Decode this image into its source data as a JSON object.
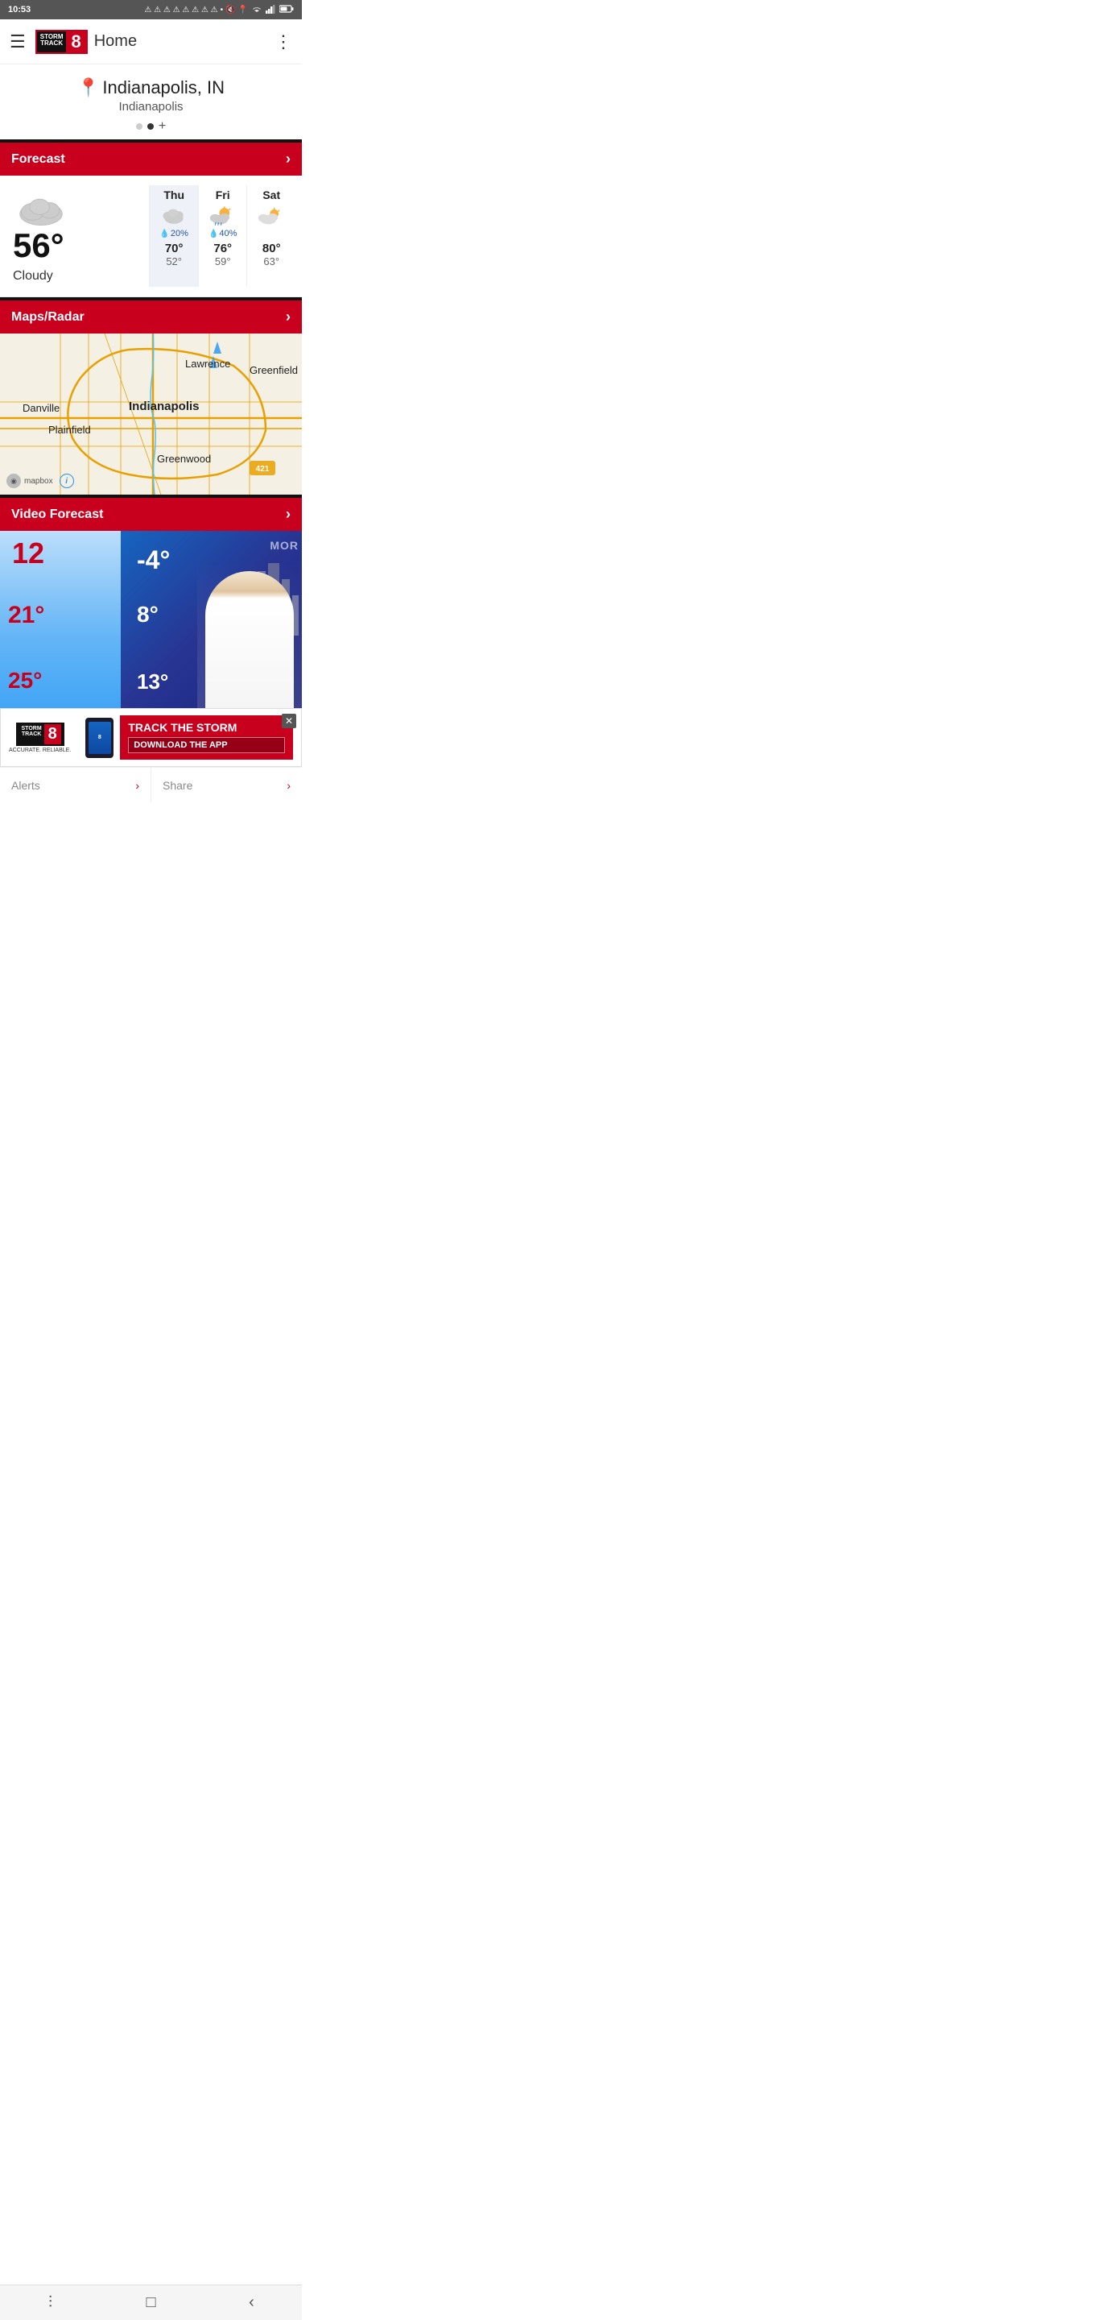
{
  "statusBar": {
    "time": "10:53",
    "icons": "⚠ ⚠ ⚠ ⚠ ⚠ ⚠ ⚠ ⚠ • 🔇 📍 WiFi Signal Battery"
  },
  "header": {
    "title": "Home",
    "menuIcon": "☰",
    "moreIcon": "⋮"
  },
  "location": {
    "city": "Indianapolis, IN",
    "sub": "Indianapolis",
    "pinIcon": "📍"
  },
  "forecast": {
    "sectionLabel": "Forecast",
    "current": {
      "temp": "56°",
      "condition": "Cloudy"
    },
    "days": [
      {
        "name": "Thu",
        "precip": "20%",
        "high": "70°",
        "low": "52°",
        "type": "cloudy"
      },
      {
        "name": "Fri",
        "precip": "40%",
        "high": "76°",
        "low": "59°",
        "type": "partly-sunny-rain"
      },
      {
        "name": "Sat",
        "precip": "",
        "high": "80°",
        "low": "63°",
        "type": "partly-sunny"
      }
    ]
  },
  "mapsRadar": {
    "sectionLabel": "Maps/Radar",
    "cities": [
      "Lawrence",
      "Greenfield",
      "Danville",
      "Indianapolis",
      "Plainfield",
      "Greenwood"
    ]
  },
  "videoForecast": {
    "sectionLabel": "Video Forecast",
    "numbers": [
      "12",
      "21°",
      "25°",
      "-4°",
      "8°",
      "13°"
    ],
    "overlayText": "MOR"
  },
  "ad": {
    "brandTop": "STORM",
    "brandBottom": "TRACK",
    "brandNum": "8",
    "tagline": "ACCURATE. RELIABLE.",
    "headline": "TRACK THE STORM",
    "cta": "DOWNLOAD THE APP"
  },
  "bottomSections": [
    {
      "label": "Alerts"
    },
    {
      "label": "Share"
    }
  ],
  "nav": {
    "items": [
      "|||",
      "□",
      "‹"
    ]
  }
}
